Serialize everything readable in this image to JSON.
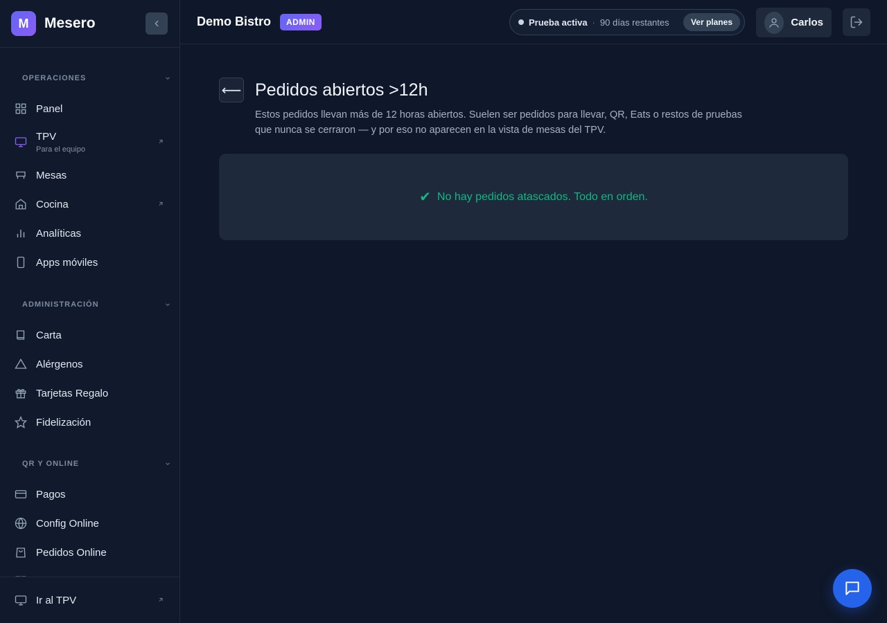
{
  "brand": {
    "logo_letter": "M",
    "name": "Mesero"
  },
  "header": {
    "workspace": "Demo Bistro",
    "badge": "ADMIN",
    "trial": {
      "status": "Prueba activa",
      "separator": "·",
      "days": "90 días restantes",
      "plans_button": "Ver planes"
    },
    "user_name": "Carlos"
  },
  "sidebar": {
    "sections": [
      {
        "title": "OPERACIONES",
        "items": [
          {
            "label": "Panel",
            "icon": "grid-icon"
          },
          {
            "label": "TPV",
            "sublabel": "Para el equipo",
            "icon": "monitor-icon",
            "external": true,
            "active": true
          },
          {
            "label": "Mesas",
            "icon": "table-icon"
          },
          {
            "label": "Cocina",
            "icon": "home-icon",
            "external": true
          },
          {
            "label": "Analíticas",
            "icon": "bar-chart-icon"
          },
          {
            "label": "Apps móviles",
            "icon": "phone-icon"
          }
        ]
      },
      {
        "title": "ADMINISTRACIÓN",
        "items": [
          {
            "label": "Carta",
            "icon": "book-icon"
          },
          {
            "label": "Alérgenos",
            "icon": "warning-icon"
          },
          {
            "label": "Tarjetas Regalo",
            "icon": "gift-icon"
          },
          {
            "label": "Fidelización",
            "icon": "star-icon"
          }
        ]
      },
      {
        "title": "QR Y ONLINE",
        "items": [
          {
            "label": "Pagos",
            "icon": "credit-card-icon"
          },
          {
            "label": "Config Online",
            "icon": "globe-icon"
          },
          {
            "label": "Pedidos Online",
            "icon": "shopping-bag-icon"
          }
        ]
      }
    ],
    "footer": {
      "label": "Ir al TPV",
      "icon": "monitor-icon"
    }
  },
  "main": {
    "title": "Pedidos abiertos >12h",
    "description": "Estos pedidos llevan más de 12 horas abiertos. Suelen ser pedidos para llevar, QR, Eats o restos de pruebas que nunca se cerraron — y por eso no aparecen en la vista de mesas del TPV.",
    "empty_icon": "✔",
    "empty_message": "No hay pedidos atascados. Todo en orden."
  },
  "colors": {
    "accent": "#6366f1",
    "success": "#10b981",
    "fab": "#2563eb",
    "background": "#0f172a"
  }
}
